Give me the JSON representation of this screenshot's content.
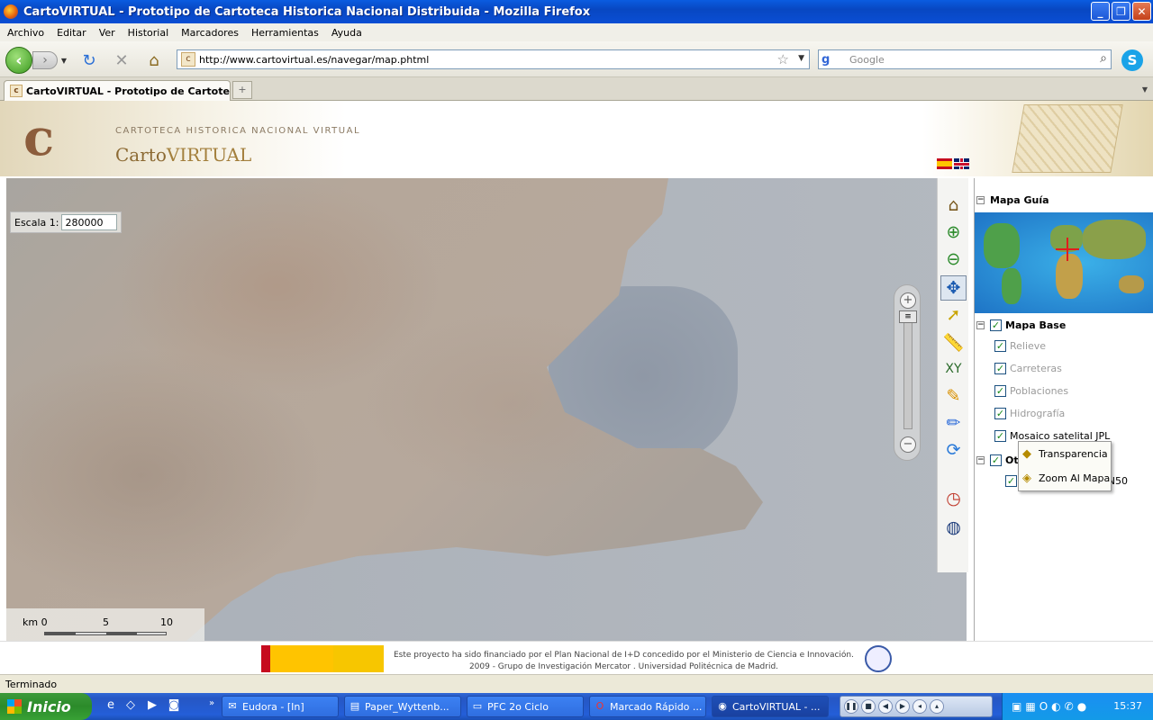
{
  "window": {
    "title": "CartoVIRTUAL - Prototipo de Cartoteca Historica Nacional Distribuida - Mozilla Firefox"
  },
  "menu": [
    "Archivo",
    "Editar",
    "Ver",
    "Historial",
    "Marcadores",
    "Herramientas",
    "Ayuda"
  ],
  "nav": {
    "url": "http://www.cartovirtual.es/navegar/map.phtml",
    "search_placeholder": "Google"
  },
  "tab": {
    "title": "CartoVIRTUAL - Prototipo de Cartote...",
    "new_tab": "+"
  },
  "header": {
    "subtitle": "CARTOTECA HISTORICA NACIONAL VIRTUAL",
    "brand_prefix": "Carto",
    "brand_suffix": "VIRTUAL"
  },
  "map": {
    "scale_label": "Escala 1:",
    "scale_value": "280000",
    "scalebar": {
      "unit": "km 0",
      "mid": "5",
      "end": "10"
    }
  },
  "panel": {
    "guide_title": "Mapa Guía",
    "base_title": "Mapa Base",
    "layers": [
      {
        "label": "Relieve",
        "checked": true
      },
      {
        "label": "Carreteras",
        "checked": true
      },
      {
        "label": "Poblaciones",
        "checked": true
      },
      {
        "label": "Hidrografía",
        "checked": true
      },
      {
        "label": "Mosaico satelital JPL",
        "checked": true
      }
    ],
    "others_title": "Otr",
    "others_layer": "TN50"
  },
  "context_menu": [
    "Transparencia",
    "Zoom Al Mapa"
  ],
  "footer": {
    "line1": "Este proyecto ha sido financiado por el Plan Nacional de I+D concedido por el Ministerio de Ciencia e Innovación.",
    "line2": "2009 - Grupo de Investigación Mercator . Universidad Politécnica de Madrid."
  },
  "status": "Terminado",
  "taskbar": {
    "start": "Inicio",
    "tasks": [
      "Eudora - [In]",
      "Paper_Wyttenb...",
      "PFC 2o Ciclo",
      "Marcado Rápido ...",
      "CartoVIRTUAL - ..."
    ],
    "clock": "15:37"
  },
  "colors": {
    "titlebar": "#0a5ce0",
    "taskbar": "#245ed8",
    "brand": "#8c6a33"
  }
}
